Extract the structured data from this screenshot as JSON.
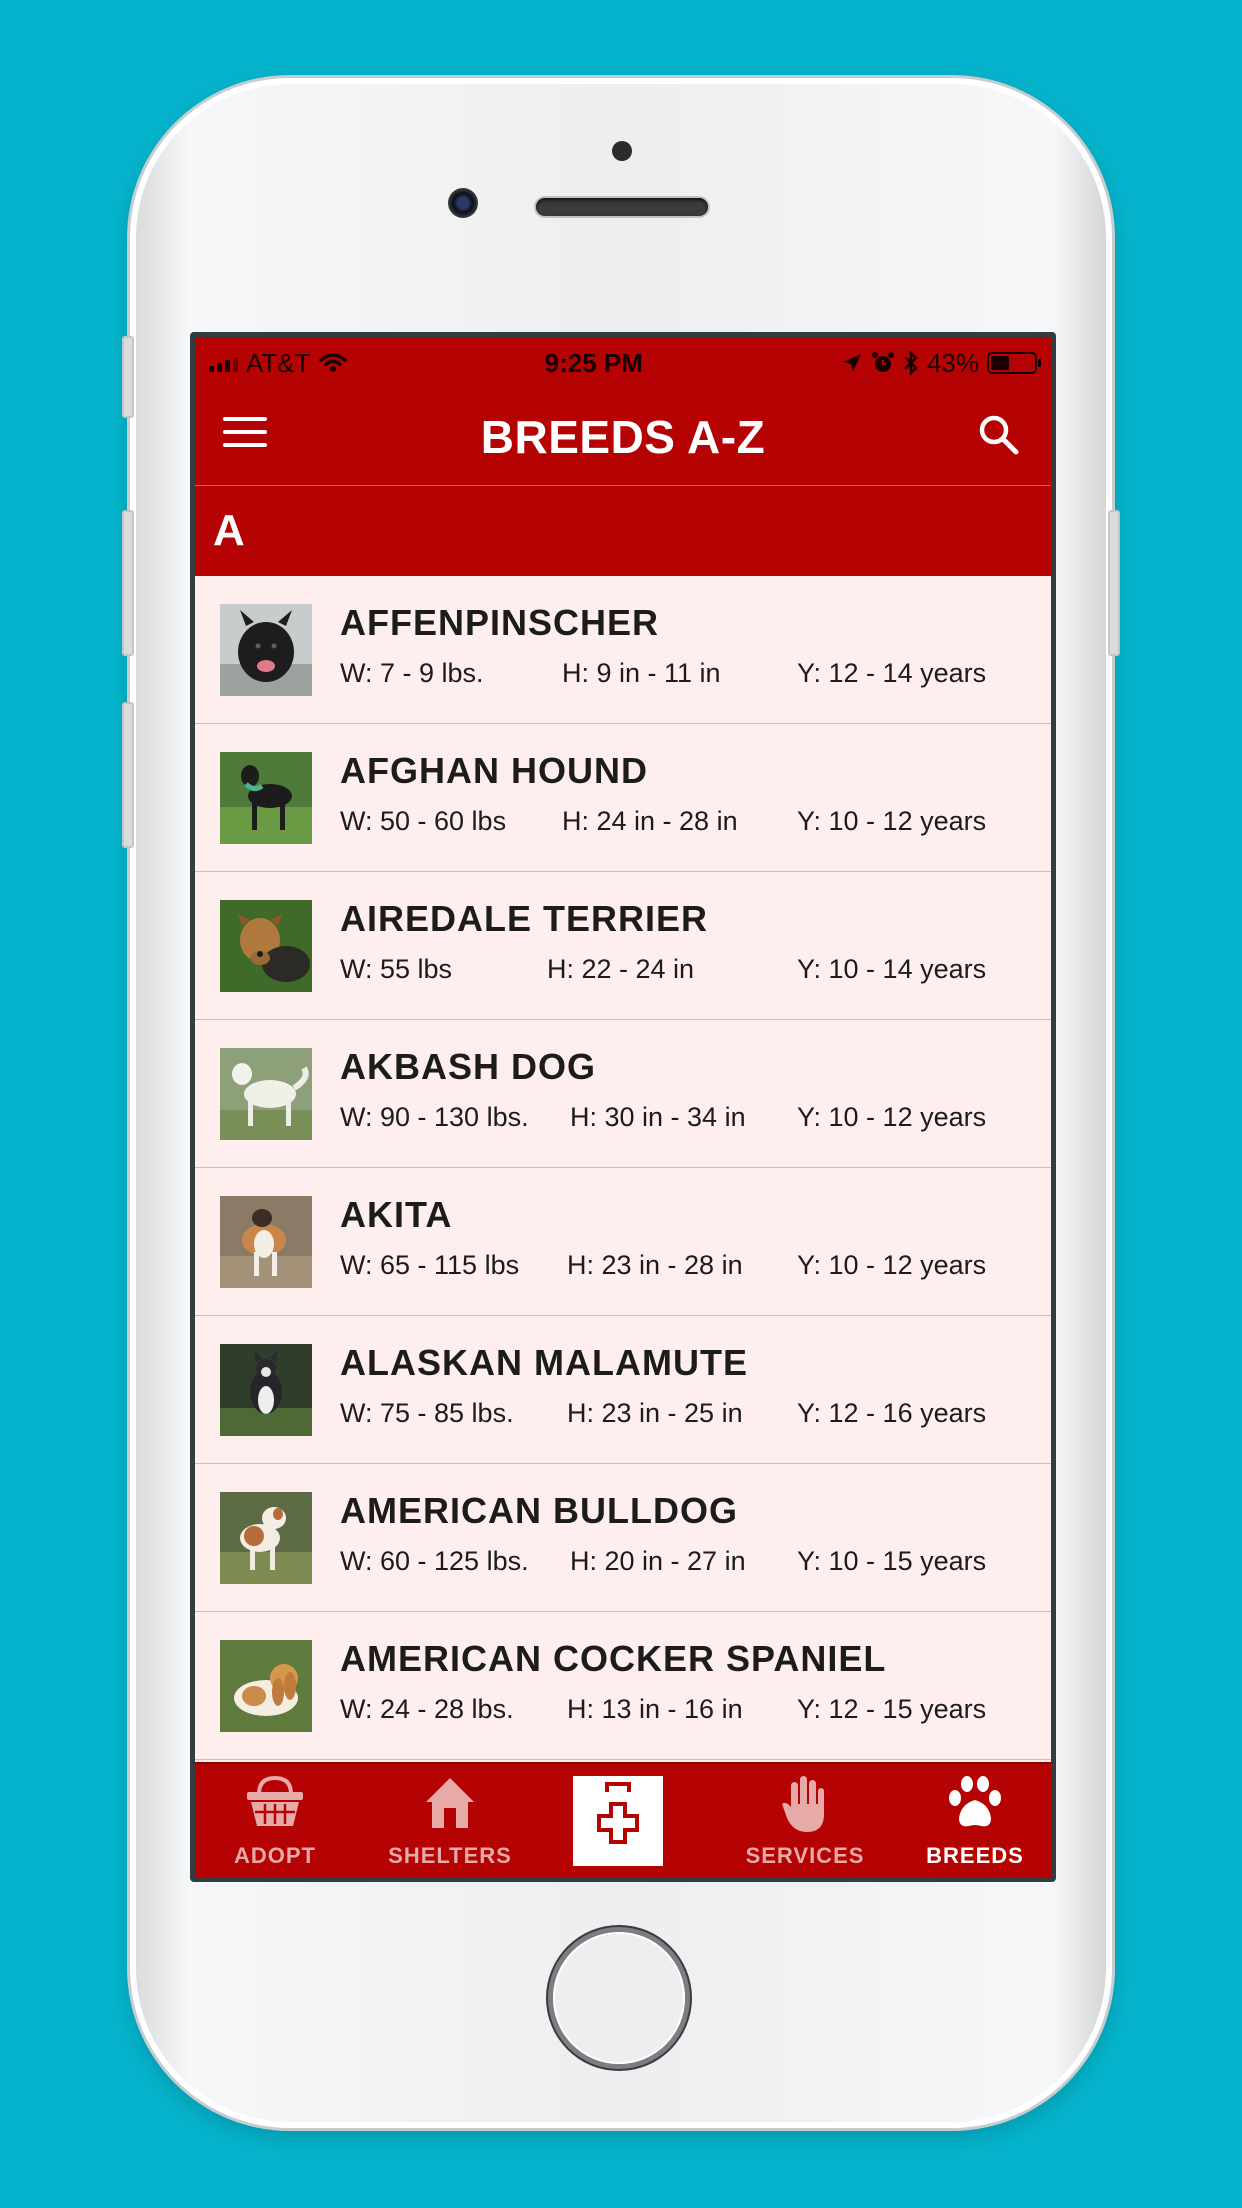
{
  "status_bar": {
    "carrier": "AT&T",
    "time": "9:25 PM",
    "battery": "43%",
    "battery_level": 0.43
  },
  "nav": {
    "title": "BREEDS A-Z"
  },
  "section": {
    "letter": "A"
  },
  "breeds": [
    {
      "name": "AFFENPINSCHER",
      "weight": "W: 7 - 9 lbs.",
      "height": "H: 9 in - 11 in",
      "years": "Y: 12 - 14 years"
    },
    {
      "name": "AFGHAN HOUND",
      "weight": "W: 50 - 60 lbs",
      "height": "H: 24 in - 28 in",
      "years": "Y: 10 - 12 years"
    },
    {
      "name": "AIREDALE TERRIER",
      "weight": "W: 55 lbs",
      "height": "H: 22 - 24 in",
      "years": "Y: 10 - 14 years"
    },
    {
      "name": "AKBASH DOG",
      "weight": "W: 90 - 130 lbs.",
      "height": "H: 30 in - 34 in",
      "years": "Y: 10 - 12 years"
    },
    {
      "name": "AKITA",
      "weight": "W: 65 - 115 lbs",
      "height": "H: 23 in - 28 in",
      "years": "Y: 10 - 12 years"
    },
    {
      "name": "ALASKAN MALAMUTE",
      "weight": "W: 75 - 85 lbs.",
      "height": "H: 23 in - 25 in",
      "years": "Y: 12 - 16 years"
    },
    {
      "name": "AMERICAN BULLDOG",
      "weight": "W: 60 - 125 lbs.",
      "height": "H: 20 in - 27 in",
      "years": "Y: 10 - 15 years"
    },
    {
      "name": "AMERICAN COCKER SPANIEL",
      "weight": "W: 24 - 28 lbs.",
      "height": "H: 13 in - 16 in",
      "years": "Y: 12 - 15 years"
    }
  ],
  "tabs": {
    "adopt": "ADOPT",
    "shelters": "SHELTERS",
    "services": "SERVICES",
    "breeds": "BREEDS"
  },
  "colors": {
    "brand_red": "#b50203",
    "list_background": "#feeeed",
    "page_background": "#05b4cc"
  },
  "icons": {
    "menu": "hamburger-menu-icon",
    "search": "magnifier-icon",
    "adopt": "basket-icon",
    "shelters": "house-icon",
    "center": "first-aid-kit-icon",
    "services": "hand-icon",
    "breeds": "paw-icon"
  }
}
